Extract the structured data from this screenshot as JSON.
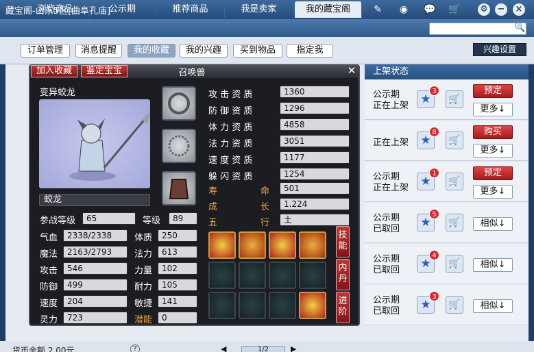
{
  "window": {
    "title": "藏宝阁-山东5区[曲阜孔庙]",
    "help_label": "助"
  },
  "tabs": [
    {
      "label": "浏览商品",
      "active": false
    },
    {
      "label": "公示期",
      "active": false
    },
    {
      "label": "推荐商品",
      "active": false
    },
    {
      "label": "我是卖家",
      "active": false
    },
    {
      "label": "我的藏宝阁",
      "active": true
    }
  ],
  "subtabs": [
    {
      "label": "订单管理",
      "active": false
    },
    {
      "label": "消息提醒",
      "active": false
    },
    {
      "label": "我的收藏",
      "active": true
    },
    {
      "label": "我的兴趣",
      "active": false
    },
    {
      "label": "买到物品",
      "active": false
    },
    {
      "label": "指定我",
      "active": false
    }
  ],
  "interest_settings_label": "兴趣设置",
  "list": {
    "header": "上架状态",
    "rows": [
      {
        "status_line1": "公示期",
        "status_line2": "正在上架",
        "count": "3",
        "primary": "预定",
        "secondary": "更多↓"
      },
      {
        "status_line1": "正在上架",
        "status_line2": "",
        "count": "8",
        "primary": "购买",
        "secondary": "更多↓"
      },
      {
        "status_line1": "公示期",
        "status_line2": "正在上架",
        "count": "1",
        "primary": "预定",
        "secondary": "更多↓"
      },
      {
        "status_line1": "公示期",
        "status_line2": "已取回",
        "count": "5",
        "primary": "",
        "secondary": "相似↓"
      },
      {
        "status_line1": "公示期",
        "status_line2": "已取回",
        "count": "4",
        "primary": "",
        "secondary": "相似↓"
      },
      {
        "status_line1": "公示期",
        "status_line2": "已取回",
        "count": "3",
        "primary": "",
        "secondary": "相似↓"
      }
    ]
  },
  "bottom": {
    "label": "货币余额",
    "amount": "2.00元",
    "pager": "1/2"
  },
  "dialog": {
    "title": "召唤兽",
    "add_fav": "加入收藏",
    "appraise": "鉴定宝宝",
    "pet_name": "变异蛟龙",
    "pet_label": "蛟龙",
    "combat_level_label": "参战等级",
    "combat_level": "65",
    "level_label": "等级",
    "level": "89",
    "stats": [
      {
        "label": "气血",
        "value": "2338/2338",
        "label2": "体质",
        "value2": "250"
      },
      {
        "label": "魔法",
        "value": "2163/2793",
        "label2": "法力",
        "value2": "613"
      },
      {
        "label": "攻击",
        "value": "546",
        "label2": "力量",
        "value2": "102"
      },
      {
        "label": "防御",
        "value": "499",
        "label2": "耐力",
        "value2": "105"
      },
      {
        "label": "速度",
        "value": "204",
        "label2": "敏捷",
        "value2": "141"
      },
      {
        "label": "灵力",
        "value": "723",
        "label2": "潜能",
        "value2": "0"
      }
    ],
    "aptitudes": [
      {
        "label": "攻 击 资 质",
        "value": "1360"
      },
      {
        "label": "防 御 资 质",
        "value": "1296"
      },
      {
        "label": "体 力 资 质",
        "value": "4858"
      },
      {
        "label": "法 力 资 质",
        "value": "3051"
      },
      {
        "label": "速 度 资 质",
        "value": "1177"
      },
      {
        "label": "躲 闪 资 质",
        "value": "1254"
      }
    ],
    "extras": [
      {
        "label1": "寿",
        "label2": "命",
        "value": "501"
      },
      {
        "label1": "成",
        "label2": "长",
        "value": "1.224"
      },
      {
        "label1": "五",
        "label2": "行",
        "value": "土"
      }
    ],
    "side_tabs": [
      "技能",
      "内丹",
      "进阶"
    ]
  }
}
